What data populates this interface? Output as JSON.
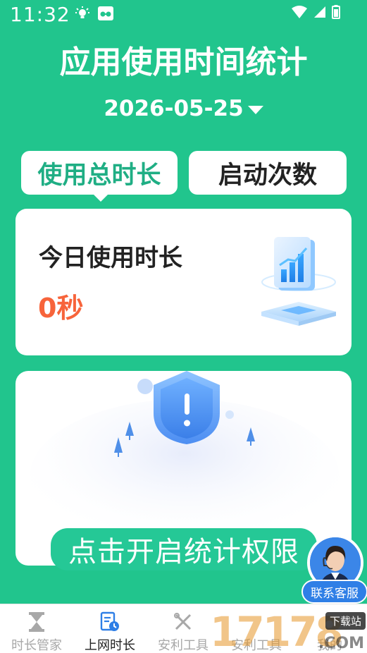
{
  "status": {
    "time": "11:32",
    "icons": [
      "bulb-icon",
      "glasses-icon",
      "wifi-icon",
      "signal-icon",
      "battery-icon"
    ]
  },
  "header": {
    "title": "应用使用时间统计",
    "date": "2026-05-25"
  },
  "tabs": [
    {
      "label": "使用总时长",
      "active": true
    },
    {
      "label": "启动次数",
      "active": false
    }
  ],
  "today_card": {
    "label": "今日使用时长",
    "value": "0秒"
  },
  "permission": {
    "button_label": "点击开启统计权限"
  },
  "support": {
    "label": "联系客服"
  },
  "nav": [
    {
      "label": "时长管家",
      "icon": "hourglass-icon",
      "active": false
    },
    {
      "label": "上网时长",
      "icon": "document-clock-icon",
      "active": true
    },
    {
      "label": "安利工具",
      "icon": "tools-icon",
      "active": false
    },
    {
      "label": "安利工具",
      "icon": "",
      "active": false
    },
    {
      "label": "我的",
      "icon": "",
      "active": false
    }
  ],
  "watermark": {
    "brand": "17178",
    "badge": "下载站",
    "suffix": ".COM"
  },
  "colors": {
    "primary": "#21c58d",
    "accent": "#f7643b",
    "tab_active_text": "#1fae84",
    "support_blue": "#2f7fe6"
  }
}
